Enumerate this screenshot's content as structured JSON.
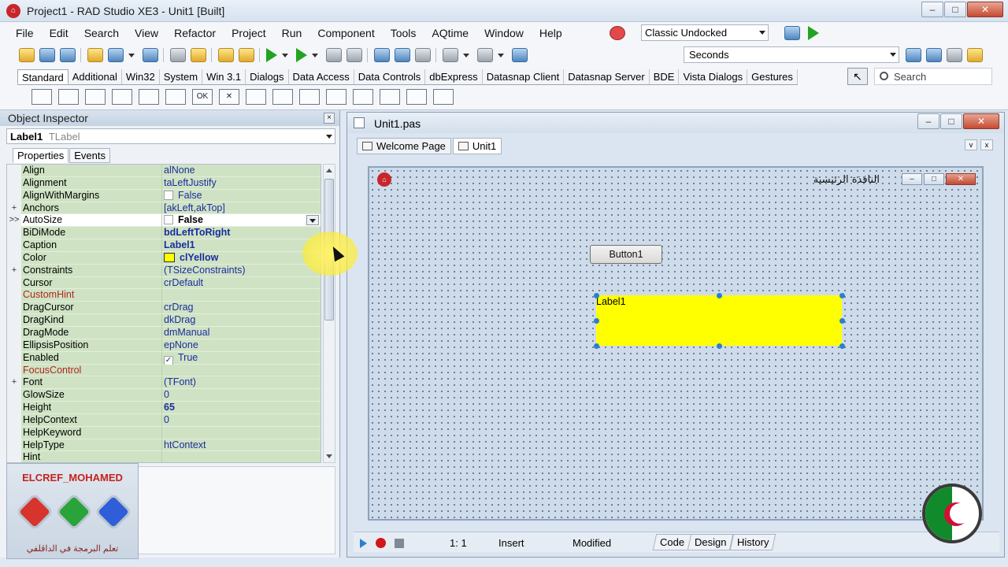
{
  "window": {
    "title": "Project1 - RAD Studio XE3 - Unit1 [Built]",
    "min": "–",
    "max": "□",
    "close": "✕"
  },
  "menu": [
    "File",
    "Edit",
    "Search",
    "View",
    "Refactor",
    "Project",
    "Run",
    "Component",
    "Tools",
    "AQtime",
    "Window",
    "Help"
  ],
  "layout_combo": "Classic Undocked",
  "timer_combo": "Seconds",
  "palette": {
    "tabs": [
      "Standard",
      "Additional",
      "Win32",
      "System",
      "Win 3.1",
      "Dialogs",
      "Data Access",
      "Data Controls",
      "dbExpress",
      "Datasnap Client",
      "Datasnap Server",
      "BDE",
      "Vista Dialogs",
      "Gestures"
    ],
    "active_tab": "Standard",
    "search_label": "Search",
    "pointer_glyph": "↖",
    "ok_glyph": "OK",
    "x_glyph": "✕"
  },
  "inspector": {
    "title": "Object Inspector",
    "close_glyph": "×",
    "object_name": "Label1",
    "object_class": "TLabel",
    "tabs": [
      "Properties",
      "Events"
    ],
    "properties": [
      {
        "name": "Align",
        "value": "alNone"
      },
      {
        "name": "Alignment",
        "value": "taLeftJustify"
      },
      {
        "name": "AlignWithMargins",
        "value": "False",
        "check": ""
      },
      {
        "name": "Anchors",
        "value": "[akLeft,akTop]",
        "expand": "+"
      },
      {
        "name": "AutoSize",
        "value": "False",
        "check": "",
        "bold": true,
        "selected": true,
        "marker": ">>"
      },
      {
        "name": "BiDiMode",
        "value": "bdLeftToRight",
        "bold": true
      },
      {
        "name": "Caption",
        "value": "Label1",
        "bold": true
      },
      {
        "name": "Color",
        "value": "clYellow",
        "bold": true,
        "swatch": "#ffff00"
      },
      {
        "name": "Constraints",
        "value": "(TSizeConstraints)",
        "expand": "+"
      },
      {
        "name": "Cursor",
        "value": "crDefault"
      },
      {
        "name": "CustomHint",
        "value": "",
        "event": true
      },
      {
        "name": "DragCursor",
        "value": "crDrag"
      },
      {
        "name": "DragKind",
        "value": "dkDrag"
      },
      {
        "name": "DragMode",
        "value": "dmManual"
      },
      {
        "name": "EllipsisPosition",
        "value": "epNone"
      },
      {
        "name": "Enabled",
        "value": "True",
        "check": "✓"
      },
      {
        "name": "FocusControl",
        "value": "",
        "event": true
      },
      {
        "name": "Font",
        "value": "(TFont)",
        "expand": "+"
      },
      {
        "name": "GlowSize",
        "value": "0"
      },
      {
        "name": "Height",
        "value": "65",
        "bold": true
      },
      {
        "name": "HelpContext",
        "value": "0"
      },
      {
        "name": "HelpKeyword",
        "value": ""
      },
      {
        "name": "HelpType",
        "value": "htContext"
      },
      {
        "name": "Hint",
        "value": ""
      }
    ]
  },
  "logo": {
    "brand": "ELCREF_MOHAMED",
    "tagline": "تعلم البرمجة في الداڤلفي"
  },
  "designer": {
    "title": "Unit1.pas",
    "tabs": [
      "Welcome Page",
      "Unit1"
    ],
    "form_caption": "النافذة الرئيسية",
    "button_caption": "Button1",
    "label_caption": "Label1",
    "label_color": "#ffff00"
  },
  "status": {
    "position": "1:   1",
    "mode": "Insert",
    "state": "Modified",
    "views": [
      "Code",
      "Design",
      "History"
    ]
  }
}
